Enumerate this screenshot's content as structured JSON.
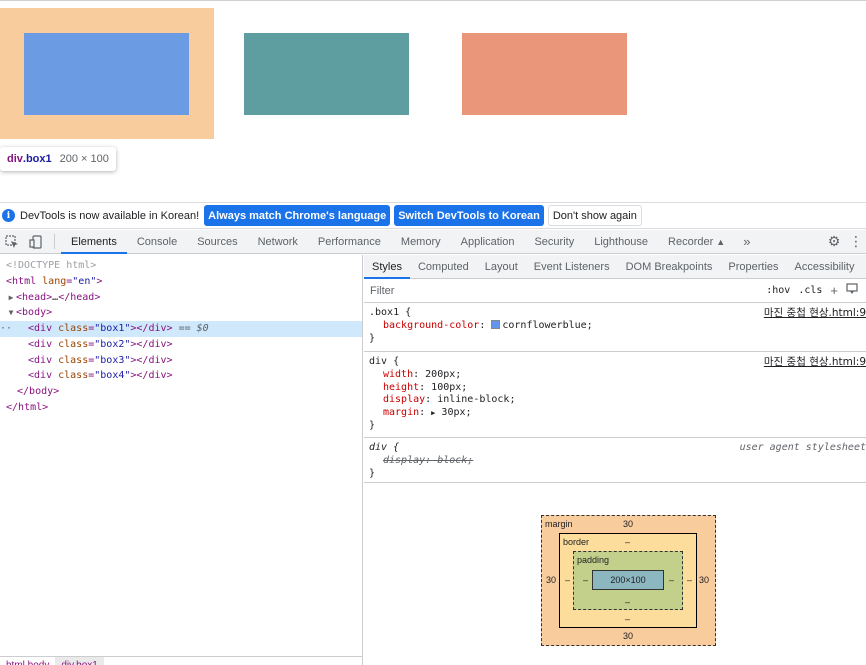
{
  "tooltip": {
    "tag": "div",
    "cls": ".box1",
    "dims": "200 × 100"
  },
  "infobar": {
    "text": "DevTools is now available in Korean!",
    "btn_match": "Always match Chrome's language",
    "btn_switch": "Switch DevTools to Korean",
    "btn_dont": "Don't show again"
  },
  "toolbar": {
    "tabs": [
      "Elements",
      "Console",
      "Sources",
      "Network",
      "Performance",
      "Memory",
      "Application",
      "Security",
      "Lighthouse",
      "Recorder"
    ],
    "more": "»"
  },
  "elements": {
    "doctype": "<!DOCTYPE html>",
    "html_tag": "html",
    "html_attr": "lang",
    "html_val": "\"en\"",
    "head": "head",
    "head_ellipsis": "…",
    "body": "body",
    "div": "div",
    "class_attr": "class",
    "box1": "\"box1\"",
    "box2": "\"box2\"",
    "box3": "\"box3\"",
    "box4": "\"box4\"",
    "sel_marker": "== $0"
  },
  "breadcrumb": [
    "html body",
    "div.box1"
  ],
  "styles": {
    "subtabs": [
      "Styles",
      "Computed",
      "Layout",
      "Event Listeners",
      "DOM Breakpoints",
      "Properties",
      "Accessibility"
    ],
    "filter_placeholder": "Filter",
    "hov": ":hov",
    "cls": ".cls",
    "rule1": {
      "selector": ".box1 {",
      "source": "마진 중첩 현상.html:9",
      "prop": "background-color",
      "value": "cornflowerblue;",
      "swatch_color": "#6495ed"
    },
    "rule2": {
      "selector": "div {",
      "source": "마진 중첩 현상.html:9",
      "decls": [
        {
          "prop": "width",
          "value": "200px;"
        },
        {
          "prop": "height",
          "value": "100px;"
        },
        {
          "prop": "display",
          "value": "inline-block;"
        },
        {
          "prop": "margin",
          "value": "30px;"
        }
      ]
    },
    "rule3": {
      "selector": "div {",
      "source": "user agent stylesheet",
      "prop": "display",
      "value": "block;"
    },
    "close_brace": "}"
  },
  "boxmodel": {
    "margin_label": "margin",
    "margin_top": "30",
    "margin_bottom": "30",
    "margin_left": "30",
    "margin_right": "30",
    "border_label": "border",
    "border_val": "–",
    "padding_label": "padding",
    "padding_val": "–",
    "content": "200×100"
  },
  "colors": {
    "margin_overlay": "#f9cc9d",
    "box1": "#6a9be3",
    "box2": "#5f9ea0",
    "box3": "#ea967b",
    "accent": "#1a73e8"
  }
}
